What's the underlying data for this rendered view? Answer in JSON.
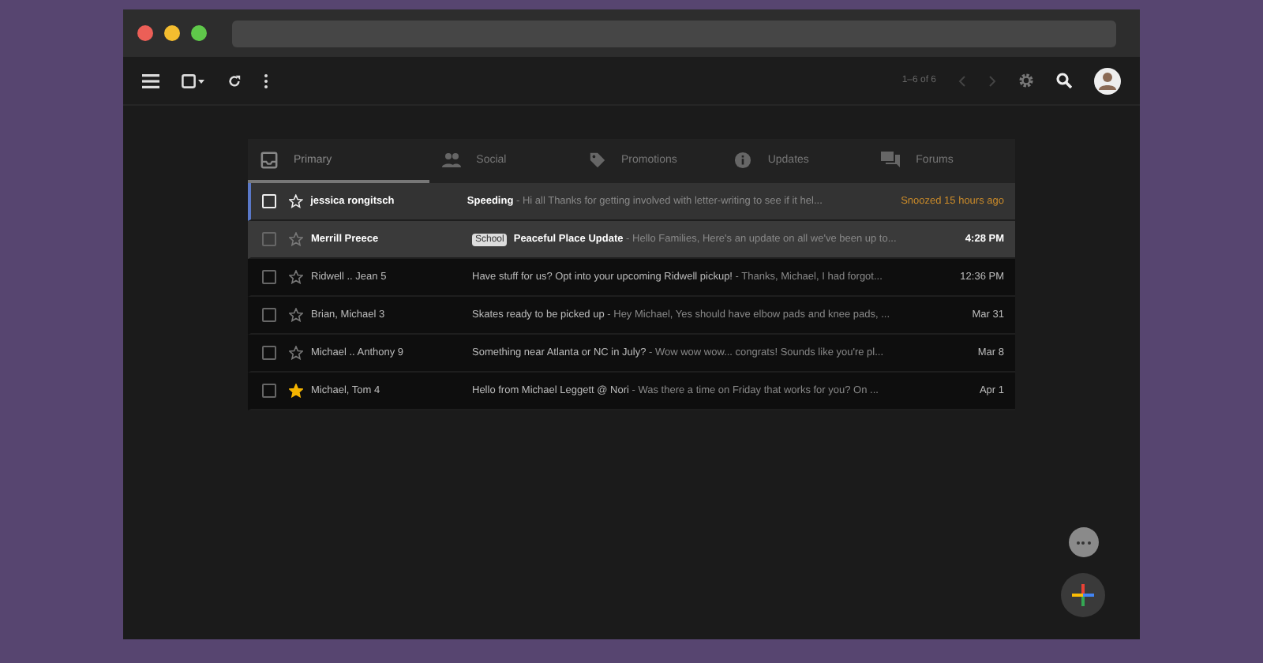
{
  "toolbar": {
    "pagination": "1–6 of 6"
  },
  "tabs": [
    {
      "label": "Primary",
      "selected": true
    },
    {
      "label": "Social",
      "selected": false
    },
    {
      "label": "Promotions",
      "selected": false
    },
    {
      "label": "Updates",
      "selected": false
    },
    {
      "label": "Forums",
      "selected": false
    }
  ],
  "emails": [
    {
      "sender": "jessica rongitsch",
      "subject": "Speeding",
      "snippet": " - Hi all Thanks for getting involved with letter-writing to see if it hel...",
      "date": "Snoozed 15 hours ago",
      "snoozed": true,
      "unread": true,
      "focused": true,
      "checked": false,
      "starred": false
    },
    {
      "sender": "Merrill Preece",
      "label": "School",
      "subject": "Peaceful Place Update",
      "snippet": " - Hello Families, Here's an update on all we've been up to...",
      "date": "4:28 PM",
      "snoozed": false,
      "unread": true,
      "focused": false,
      "checked": false,
      "starred": false
    },
    {
      "sender": "Ridwell .. Jean 5",
      "subject": "Have stuff for us? Opt into your upcoming Ridwell pickup!",
      "snippet": " - Thanks, Michael, I had forgot...",
      "date": "12:36 PM",
      "snoozed": false,
      "unread": false,
      "focused": false,
      "checked": false,
      "starred": false
    },
    {
      "sender": "Brian, Michael 3",
      "subject": "Skates ready to be picked up",
      "snippet": " - Hey Michael, Yes should have elbow pads and knee pads, ...",
      "date": "Mar 31",
      "snoozed": false,
      "unread": false,
      "focused": false,
      "checked": false,
      "starred": false
    },
    {
      "sender": "Michael .. Anthony 9",
      "subject": "Something near Atlanta or NC in July?",
      "snippet": " - Wow wow wow... congrats! Sounds like you're pl...",
      "date": "Mar 8",
      "snoozed": false,
      "unread": false,
      "focused": false,
      "checked": false,
      "starred": false
    },
    {
      "sender": "Michael, Tom 4",
      "subject": "Hello from Michael Leggett @ Nori",
      "snippet": " - Was there a time on Friday that works for you? On ...",
      "date": "Apr 1",
      "snoozed": false,
      "unread": false,
      "focused": false,
      "checked": false,
      "starred": true
    }
  ]
}
